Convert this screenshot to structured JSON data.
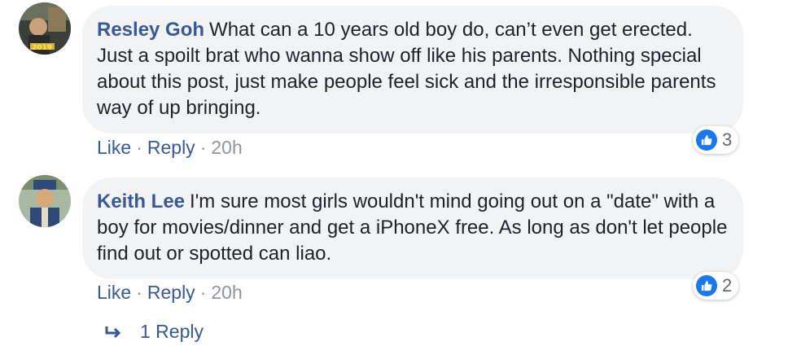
{
  "comments": [
    {
      "author": "Resley Goh",
      "text": "What can a 10 years old boy do, can’t even get erected. Just a spoilt brat who wanna show off like his parents. Nothing special about this post, just make people feel sick and the irresponsible parents way of up bringing.",
      "like_label": "Like",
      "reply_label": "Reply",
      "time": "20h",
      "reaction_count": "3"
    },
    {
      "author": "Keith Lee",
      "text": "I'm sure most girls wouldn't mind going out on a \"date\" with a boy for movies/dinner and get a iPhoneX free. As long as don't let people find out or spotted can liao.",
      "like_label": "Like",
      "reply_label": "Reply",
      "time": "20h",
      "reaction_count": "2"
    }
  ],
  "replies_link": {
    "label": "1 Reply",
    "icon": "reply-arrow-icon"
  },
  "colors": {
    "link": "#385898",
    "bubble": "#f2f3f5",
    "like_blue": "#1877f2"
  }
}
